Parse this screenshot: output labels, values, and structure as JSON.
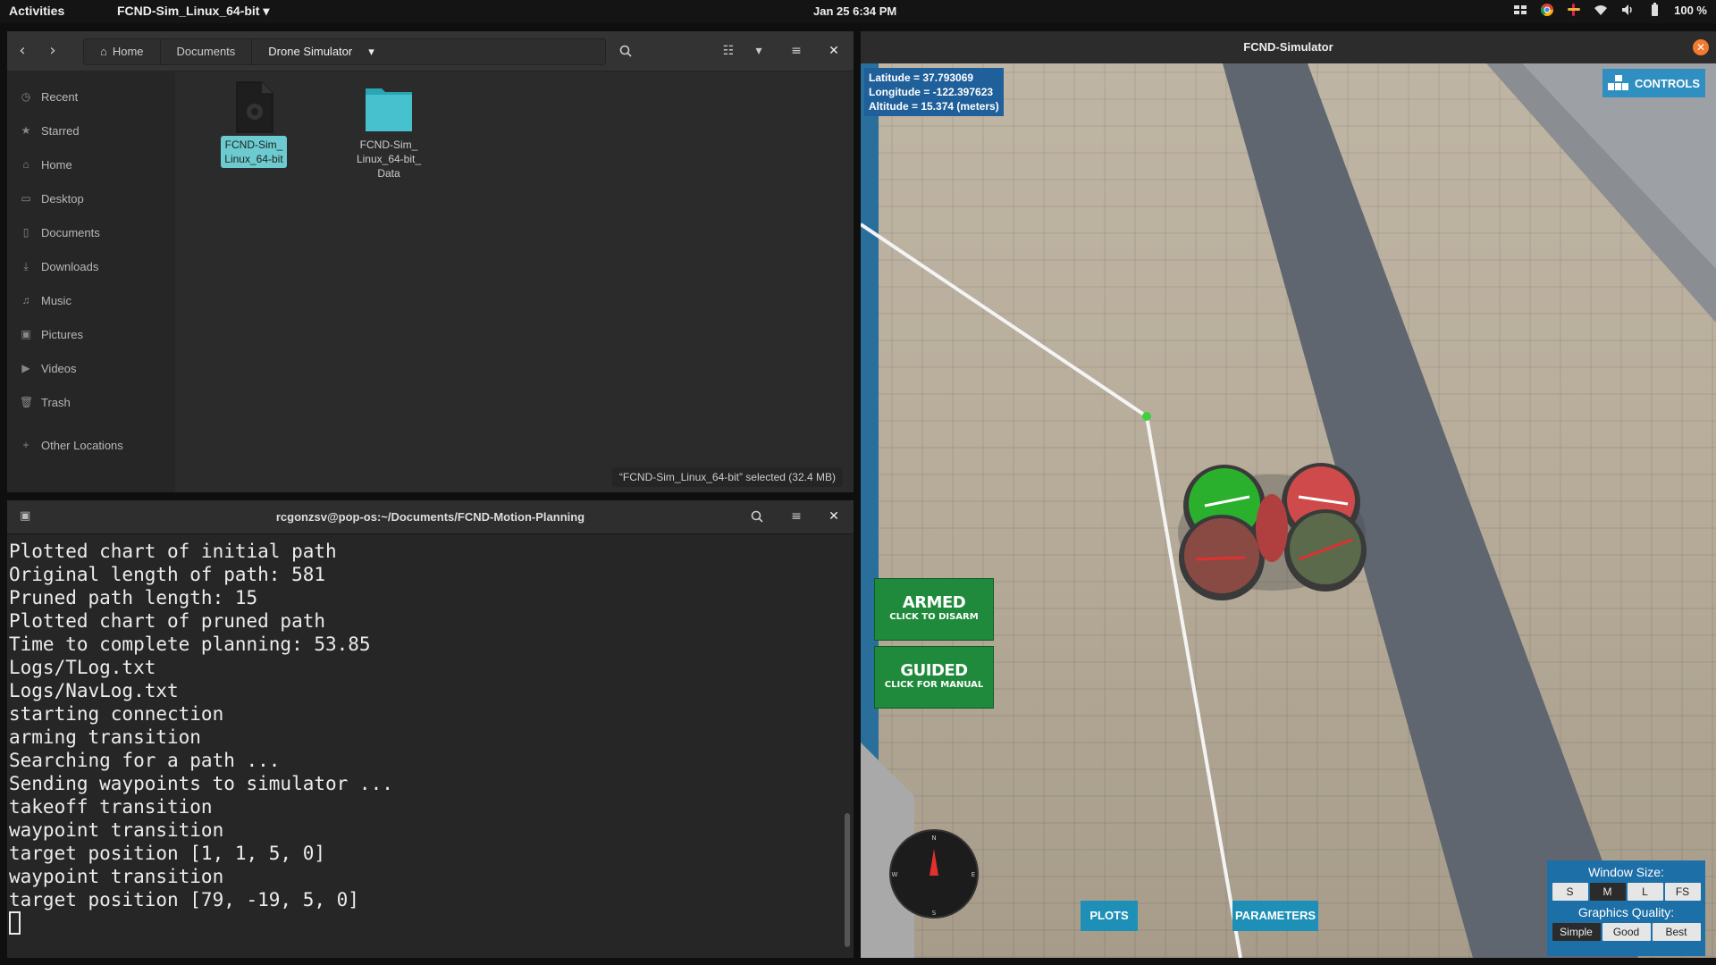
{
  "topbar": {
    "activities": "Activities",
    "app_menu": "FCND-Sim_Linux_64-bit ▾",
    "clock": "Jan 25  6:34 PM",
    "battery": "100 %"
  },
  "files": {
    "breadcrumbs": [
      "Home",
      "Documents",
      "Drone Simulator"
    ],
    "sidebar": [
      {
        "label": "Recent",
        "icon": "clock-icon"
      },
      {
        "label": "Starred",
        "icon": "star-icon"
      },
      {
        "label": "Home",
        "icon": "home-icon"
      },
      {
        "label": "Desktop",
        "icon": "desktop-icon"
      },
      {
        "label": "Documents",
        "icon": "document-icon"
      },
      {
        "label": "Downloads",
        "icon": "download-icon"
      },
      {
        "label": "Music",
        "icon": "music-icon"
      },
      {
        "label": "Pictures",
        "icon": "picture-icon"
      },
      {
        "label": "Videos",
        "icon": "video-icon"
      },
      {
        "label": "Trash",
        "icon": "trash-icon"
      },
      {
        "label": "Other Locations",
        "icon": "plus-icon"
      }
    ],
    "items": [
      {
        "label": "FCND-Sim_\nLinux_64-bit",
        "type": "executable",
        "selected": true
      },
      {
        "label": "FCND-Sim_\nLinux_64-bit_\nData",
        "type": "folder",
        "selected": false
      }
    ],
    "status": "“FCND-Sim_Linux_64-bit” selected  (32.4 MB)"
  },
  "terminal": {
    "title": "rcgonzsv@pop-os:~/Documents/FCND-Motion-Planning",
    "lines": [
      "Plotted chart of initial path",
      "Original length of path: 581",
      "Pruned path length: 15",
      "Plotted chart of pruned path",
      "Time to complete planning: 53.85",
      "Logs/TLog.txt",
      "Logs/NavLog.txt",
      "starting connection",
      "arming transition",
      "Searching for a path ...",
      "Sending waypoints to simulator ...",
      "takeoff transition",
      "waypoint transition",
      "target position [1, 1, 5, 0]",
      "waypoint transition",
      "target position [79, -19, 5, 0]"
    ]
  },
  "simulator": {
    "title": "FCND-Simulator",
    "latitude": "Latitude = 37.793069",
    "longitude": "Longitude = -122.397623",
    "altitude": "Altitude = 15.374 (meters)",
    "controls_label": "CONTROLS",
    "armed_big": "ARMED",
    "armed_small": "CLICK TO DISARM",
    "guided_big": "GUIDED",
    "guided_small": "CLICK FOR MANUAL",
    "plots_label": "PLOTS",
    "parameters_label": "PARAMETERS",
    "window_size_label": "Window Size:",
    "window_sizes": [
      "S",
      "M",
      "L",
      "FS"
    ],
    "window_size_selected": "M",
    "graphics_label": "Graphics Quality:",
    "graphics_options": [
      "Simple",
      "Good",
      "Best"
    ],
    "graphics_selected": "Good",
    "compass_labels": [
      "N",
      "E",
      "S",
      "W"
    ]
  }
}
